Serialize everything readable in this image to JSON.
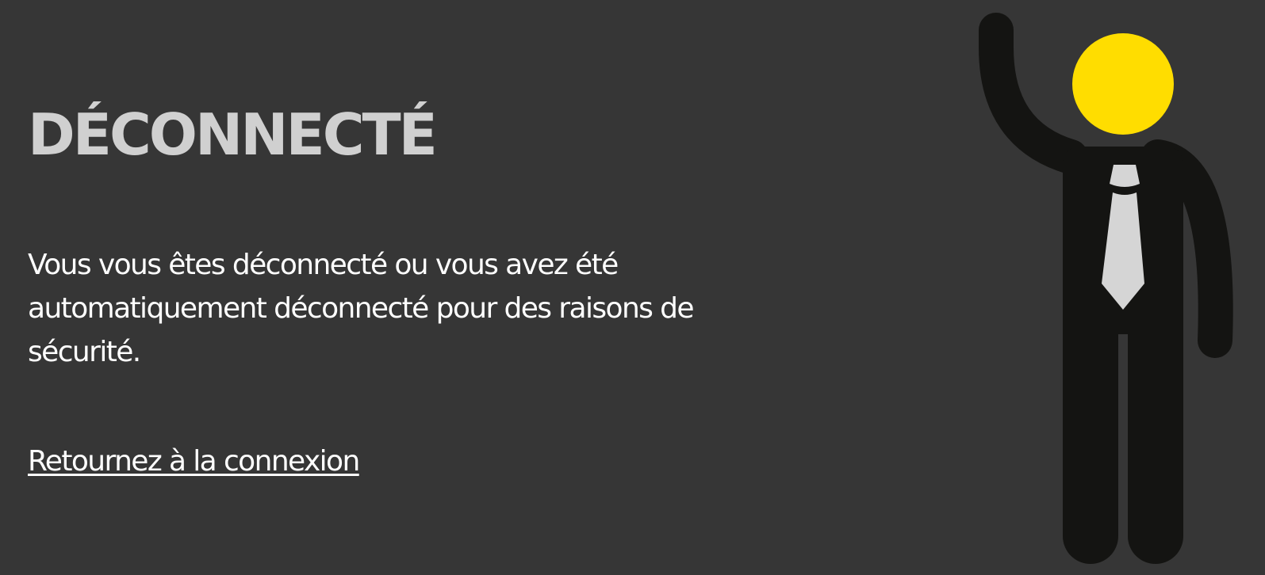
{
  "page": {
    "title": "DÉCONNECTÉ",
    "message": "Vous vous êtes déconnecté ou vous avez été automatiquement déconnecté pour des raisons de sécurité.",
    "login_link_label": "Retournez à la connexion"
  },
  "colors": {
    "background": "#363636",
    "title": "#d0d0d0",
    "text": "#ffffff",
    "figure_body": "#141412",
    "figure_head": "#ffdd00",
    "figure_tie": "#d5d5d5"
  },
  "illustration": {
    "icon": "waving-businessman-icon"
  }
}
